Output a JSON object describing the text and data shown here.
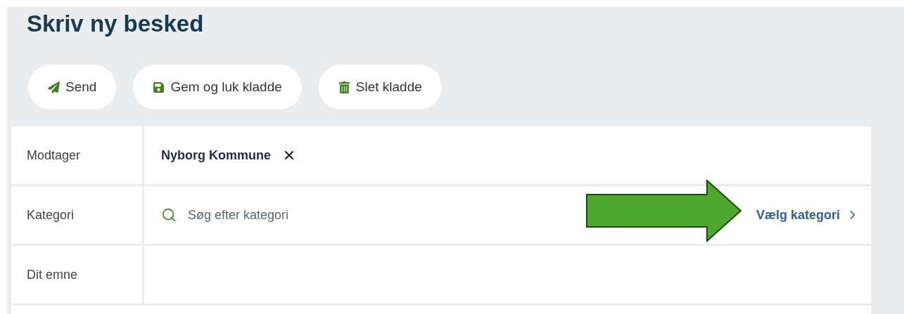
{
  "title": "Skriv ny besked",
  "buttons": [
    {
      "label": "Send",
      "kind": "send"
    },
    {
      "label": "Gem og luk kladde",
      "kind": "save"
    },
    {
      "label": "Slet kladde",
      "kind": "delete"
    }
  ],
  "rows": [
    {
      "label": "Modtager",
      "kind": "recipient",
      "value": "Nyborg Kommune"
    },
    {
      "label": "Kategori",
      "kind": "search",
      "placeholder": "Søg efter kategori",
      "action": "Vælg kategori"
    },
    {
      "label": "Dit emne",
      "kind": "text"
    }
  ]
}
